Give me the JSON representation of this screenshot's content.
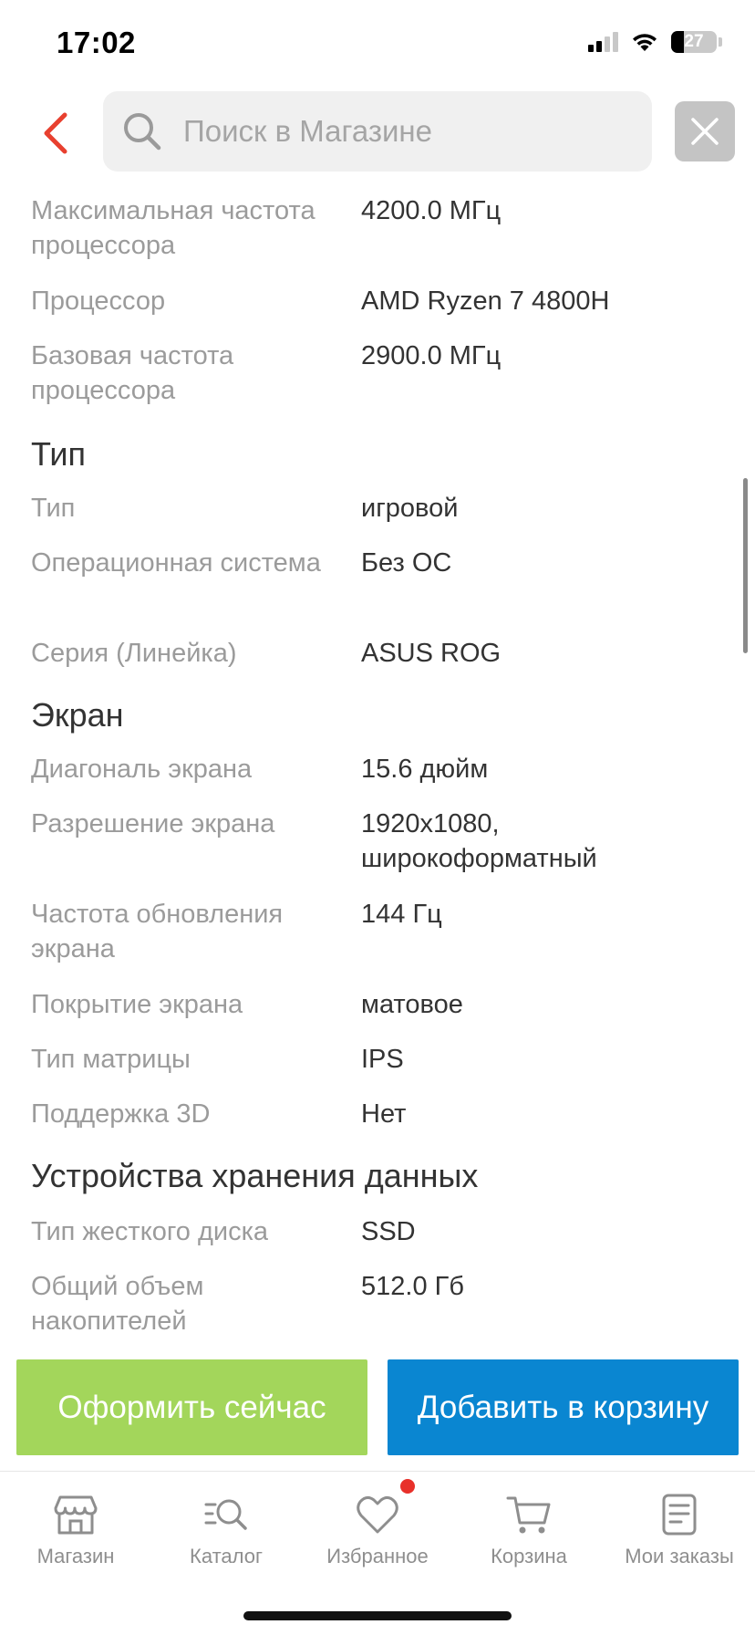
{
  "status_bar": {
    "time": "17:02",
    "battery": "27",
    "battery_level": 0.27
  },
  "header": {
    "search_placeholder": "Поиск в Магазине"
  },
  "specs": {
    "cpu": [
      {
        "label": "Максимальная частота процессора",
        "value": "4200.0 МГц"
      },
      {
        "label": "Процессор",
        "value": "AMD Ryzen 7 4800H"
      },
      {
        "label": "Базовая частота процессора",
        "value": "2900.0 МГц"
      }
    ],
    "type_section": {
      "title": "Тип",
      "rows": [
        {
          "label": "Тип",
          "value": "игровой"
        },
        {
          "label": "Операционная система",
          "value": "Без ОС"
        },
        {
          "label": "Серия (Линейка)",
          "value": "ASUS ROG"
        }
      ]
    },
    "screen_section": {
      "title": "Экран",
      "rows": [
        {
          "label": "Диагональ экрана",
          "value": "15.6 дюйм"
        },
        {
          "label": "Разрешение экрана",
          "value": "1920x1080, широкоформатный"
        },
        {
          "label": "Частота обновления экрана",
          "value": "144 Гц"
        },
        {
          "label": "Покрытие экрана",
          "value": "матовое"
        },
        {
          "label": "Тип матрицы",
          "value": "IPS"
        },
        {
          "label": "Поддержка 3D",
          "value": "Нет"
        }
      ]
    },
    "storage_section": {
      "title": "Устройства хранения данных",
      "rows": [
        {
          "label": "Тип жесткого диска",
          "value": "SSD"
        },
        {
          "label": "Общий объем накопителей",
          "value": "512.0 Гб"
        }
      ]
    }
  },
  "actions": {
    "buy_now": "Оформить сейчас",
    "add_to_cart": "Добавить в корзину"
  },
  "tabbar": {
    "items": [
      {
        "label": "Магазин",
        "icon": "shop-icon"
      },
      {
        "label": "Каталог",
        "icon": "catalog-search-icon"
      },
      {
        "label": "Избранное",
        "icon": "heart-icon",
        "badge": true
      },
      {
        "label": "Корзина",
        "icon": "cart-icon"
      },
      {
        "label": "Мои заказы",
        "icon": "orders-icon"
      }
    ]
  },
  "colors": {
    "accent_back": "#e8402f",
    "buy_button": "#a3d65b",
    "cart_button": "#0a86d1",
    "badge": "#e8302a"
  }
}
